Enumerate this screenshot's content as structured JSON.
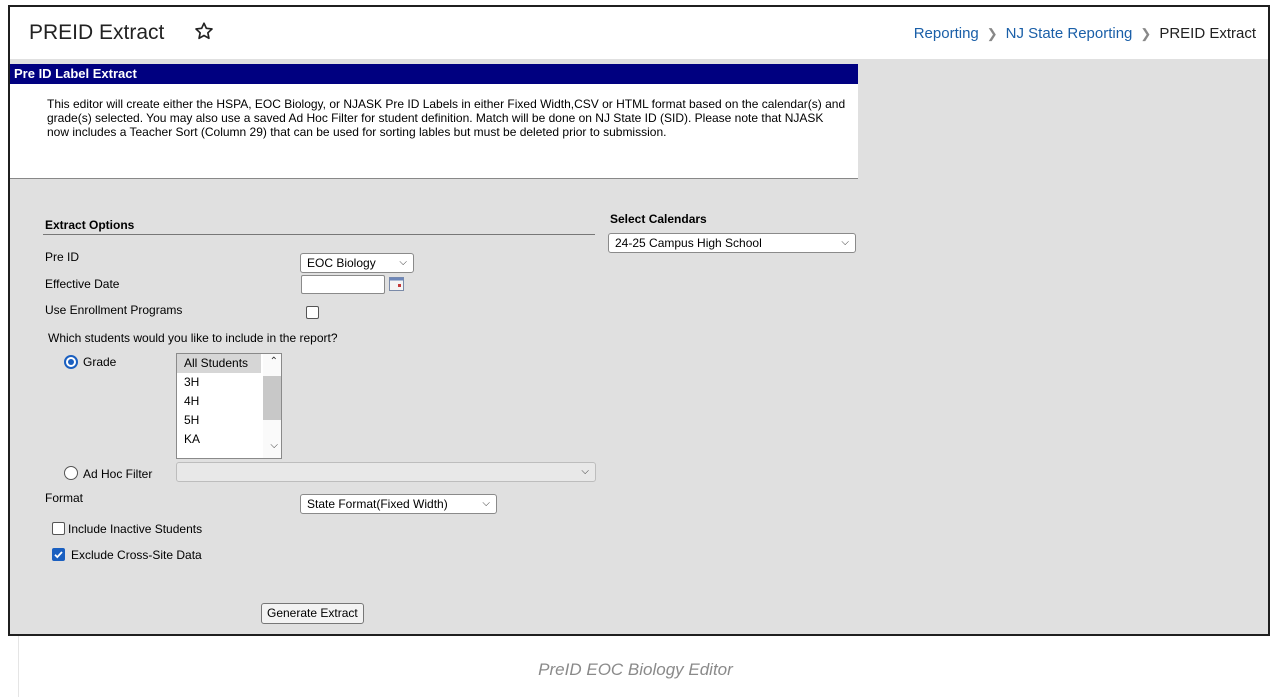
{
  "header": {
    "title": "PREID Extract",
    "breadcrumb": [
      "Reporting",
      "NJ State Reporting",
      "PREID Extract"
    ]
  },
  "panel": {
    "title": "Pre ID Label Extract",
    "description": "This editor will create either the HSPA, EOC Biology, or NJASK Pre ID Labels in either Fixed Width,CSV or HTML format based on the calendar(s) and grade(s) selected. You may also use a saved Ad Hoc Filter for student definition. Match will be done on NJ State ID (SID). Please note that NJASK now includes a Teacher Sort (Column 29) that can be used for sorting lables but must be deleted prior to submission."
  },
  "extract_options": {
    "heading": "Extract Options",
    "pre_id_label": "Pre ID",
    "pre_id_value": "EOC Biology",
    "effective_date_label": "Effective Date",
    "effective_date_value": "",
    "use_enrollment_label": "Use Enrollment Programs",
    "use_enrollment_checked": false,
    "students_question": "Which students would you like to include in the report?",
    "grade_label": "Grade",
    "grade_selected": true,
    "grades": [
      "All Students",
      "3H",
      "4H",
      "5H",
      "KA"
    ],
    "adhoc_label": "Ad Hoc Filter",
    "adhoc_value": "",
    "format_label": "Format",
    "format_value": "State Format(Fixed Width)",
    "include_inactive_label": "Include Inactive Students",
    "include_inactive_checked": false,
    "exclude_cross_site_label": "Exclude Cross-Site Data",
    "exclude_cross_site_checked": true,
    "generate_button": "Generate Extract"
  },
  "calendars": {
    "heading": "Select Calendars",
    "value": "24-25 Campus High School"
  },
  "caption": "PreID EOC Biology Editor",
  "colors": {
    "panel_title_bg": "#000080",
    "link": "#1a5fa8",
    "checkbox": "#1a5fc0"
  }
}
